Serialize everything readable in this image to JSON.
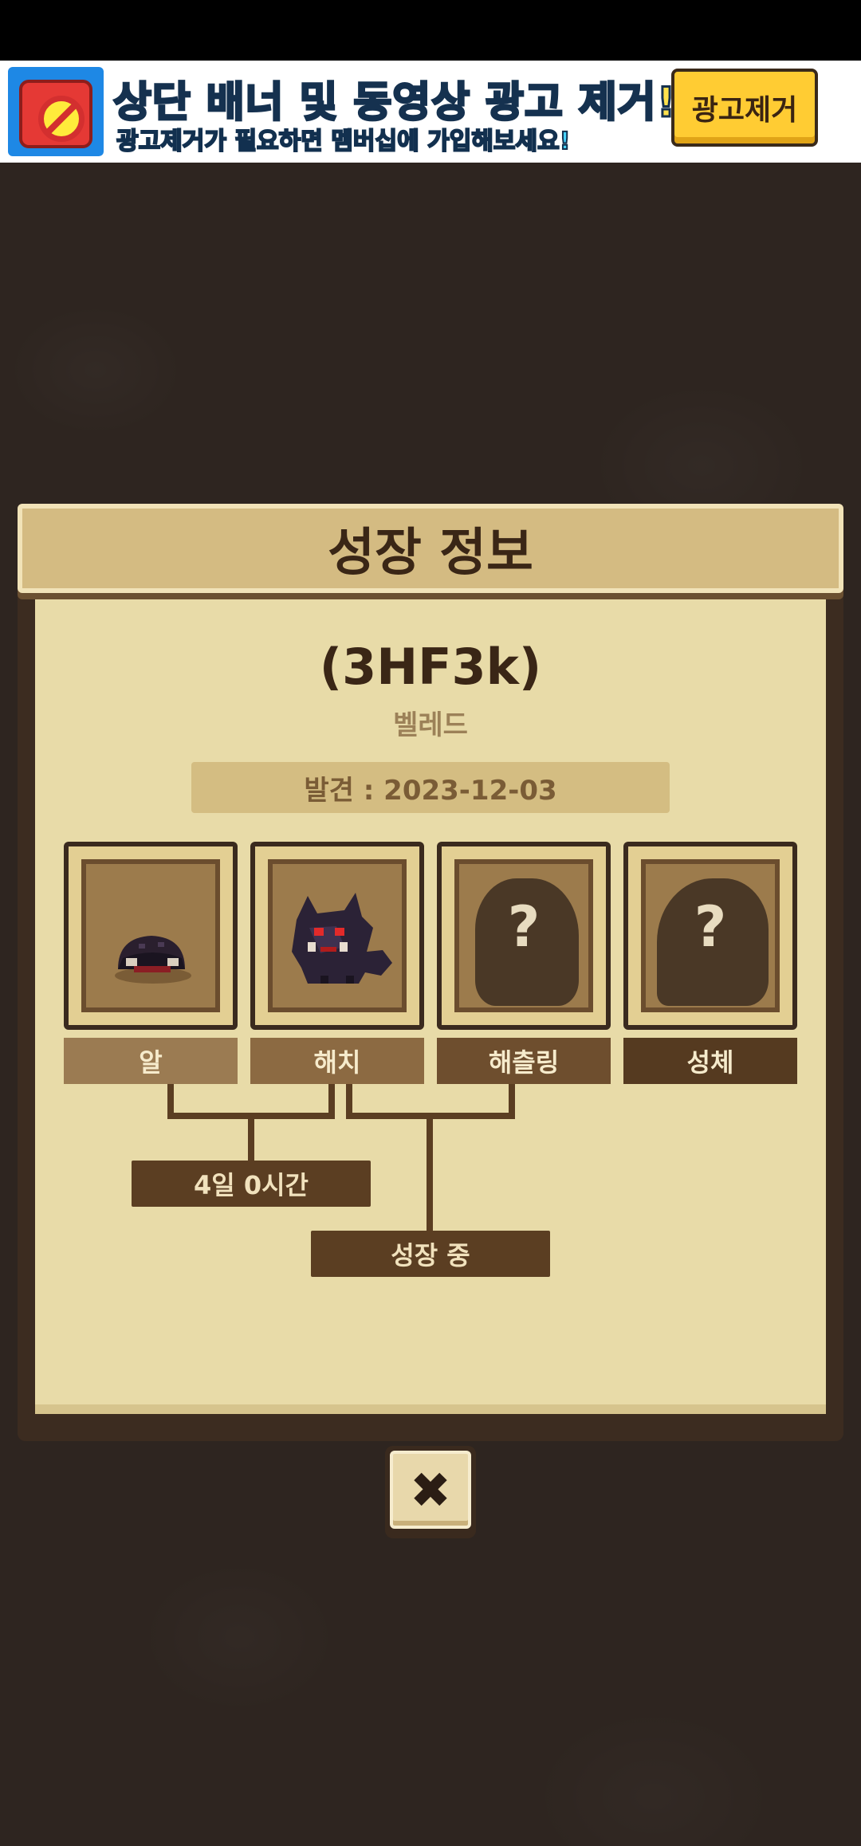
{
  "ad_banner": {
    "title": "상단 배너 및 동영상 광고 제거!",
    "subtitle": "광고제거가 필요하면 멤버십에 가입해보세요!",
    "remove_button": "광고제거"
  },
  "panel": {
    "title": "성장 정보",
    "pet_name": "(3HF3k)",
    "species": "벨레드",
    "found_date": "발견 : 2023-12-03"
  },
  "stages": [
    {
      "label": "알",
      "icon": "egg-sprite",
      "color": "#9b7b52"
    },
    {
      "label": "해치",
      "icon": "hatchling-dragon-sprite",
      "color": "#8c6a42"
    },
    {
      "label": "해츨링",
      "icon": "unknown-silhouette",
      "color": "#6e4e2e"
    },
    {
      "label": "성체",
      "icon": "unknown-silhouette",
      "color": "#553a20"
    }
  ],
  "time_elapsed": "4일 0시간",
  "growth_status": "성장 중",
  "close_button": "✖"
}
